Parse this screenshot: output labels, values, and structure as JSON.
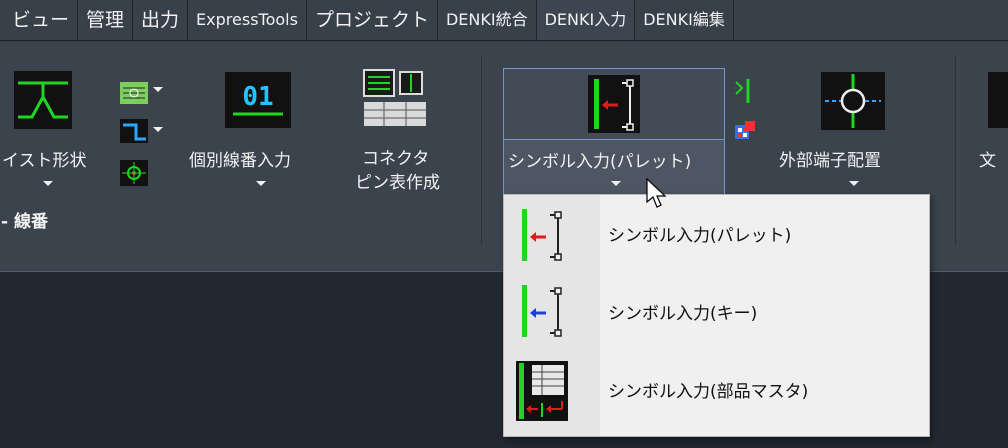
{
  "tabs": [
    {
      "label": "ビュー"
    },
    {
      "label": "管理"
    },
    {
      "label": "出力"
    },
    {
      "label": "ExpressTools"
    },
    {
      "label": "プロジェクト"
    },
    {
      "label": "DENKI統合"
    },
    {
      "label": "DENKI入力"
    },
    {
      "label": "DENKI編集"
    }
  ],
  "ribbon": {
    "twist_shape": {
      "label": "イスト形状"
    },
    "individual_wire_number": {
      "label": "個別線番入力",
      "icon_text": "01"
    },
    "connector_pin_table": {
      "line1": "コネクタ",
      "line2": "ピン表作成"
    },
    "symbol_input_palette": {
      "label": "シンボル入力(パレット)"
    },
    "external_terminal": {
      "label": "外部端子配置"
    },
    "text_partial": {
      "label": "文"
    },
    "panel_title": "- 線番"
  },
  "dropdown": {
    "items": [
      {
        "label": "シンボル入力(パレット)",
        "arrow_color": "#e01b1b"
      },
      {
        "label": "シンボル入力(キー)",
        "arrow_color": "#1a3fe0"
      },
      {
        "label": "シンボル入力(部品マスタ)"
      }
    ]
  },
  "colors": {
    "accent_green": "#22d422",
    "highlight_border": "#6d9bd1",
    "ribbon_bg": "#3b434d",
    "workspace_bg": "#212830"
  }
}
